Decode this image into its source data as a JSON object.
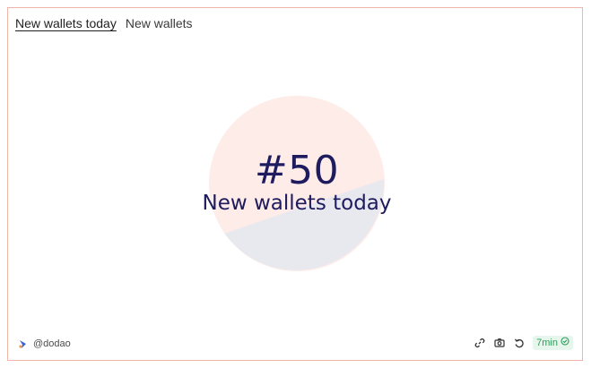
{
  "tabs": [
    {
      "label": "New wallets today",
      "active": true
    },
    {
      "label": "New wallets",
      "active": false
    }
  ],
  "counter": {
    "value": "#50",
    "label": "New wallets today"
  },
  "footer": {
    "author": "@dodao",
    "badge_text": "7min"
  },
  "icons": {
    "brand": "dune-logo-icon",
    "link": "link-icon",
    "camera": "camera-icon",
    "refresh": "refresh-icon",
    "check": "check-circle-icon"
  },
  "colors": {
    "border": "#f0b4a8",
    "text_primary": "#1e1b5e",
    "pie_top": "#fdece8",
    "pie_bottom": "#e8e8ef",
    "badge_bg": "#e6f6ec",
    "badge_fg": "#2e9b5a"
  }
}
